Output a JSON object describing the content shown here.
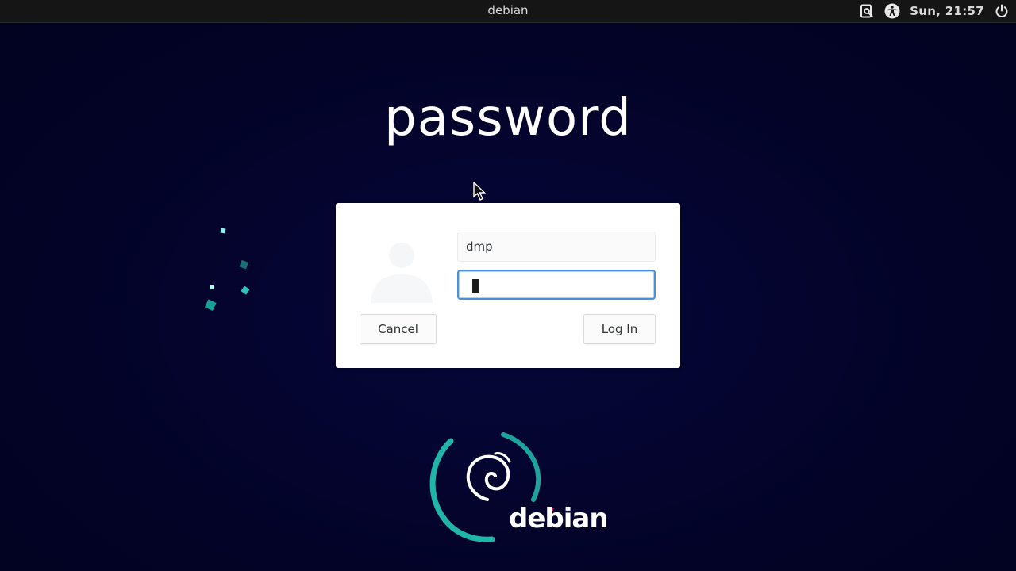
{
  "topbar": {
    "hostname": "debian",
    "clock": "Sun, 21:57",
    "icons": [
      "screen-reader-icon",
      "accessibility-icon",
      "power-icon"
    ]
  },
  "heading": "password",
  "dialog": {
    "username": "dmp",
    "password_value": "",
    "cancel_label": "Cancel",
    "login_label": "Log In"
  },
  "branding": {
    "logo_text": "debian"
  },
  "colors": {
    "background": "#03032a",
    "topbar": "#151515",
    "focus": "#4a90d9",
    "swirl": "#1fb5a8",
    "spinner": "#6ee6e2"
  }
}
